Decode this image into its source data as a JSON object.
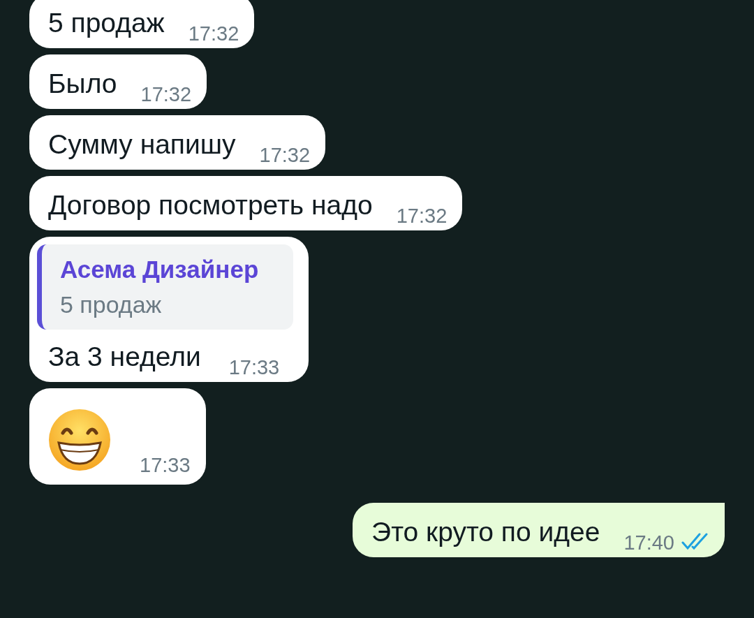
{
  "messages": [
    {
      "kind": "text",
      "outgoing": false,
      "text": "5 продаж",
      "time": "17:32"
    },
    {
      "kind": "text",
      "outgoing": false,
      "text": "Было",
      "time": "17:32"
    },
    {
      "kind": "text",
      "outgoing": false,
      "text": "Сумму напишу",
      "time": "17:32"
    },
    {
      "kind": "text",
      "outgoing": false,
      "text": "Договор посмотреть надо",
      "time": "17:32"
    },
    {
      "kind": "quote",
      "outgoing": false,
      "quote": {
        "author": "Асема Дизайнер",
        "text": "5 продаж"
      },
      "text": "За 3 недели",
      "time": "17:33"
    },
    {
      "kind": "emoji",
      "outgoing": false,
      "time": "17:33"
    },
    {
      "kind": "text",
      "outgoing": true,
      "text": "Это круто по идее",
      "time": "17:40",
      "read": true
    }
  ]
}
